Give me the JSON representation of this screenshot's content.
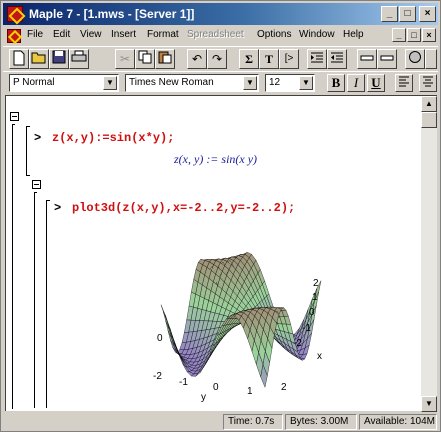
{
  "window": {
    "title": "Maple 7 - [1.mws - [Server 1]]"
  },
  "title_buttons": [
    "_",
    "□",
    "×"
  ],
  "menu": {
    "items": [
      {
        "label": "File"
      },
      {
        "label": "Edit"
      },
      {
        "label": "View"
      },
      {
        "label": "Insert"
      },
      {
        "label": "Format"
      },
      {
        "label": "Spreadsheet",
        "disabled": true
      },
      {
        "label": "Options"
      },
      {
        "label": "Window"
      },
      {
        "label": "Help"
      }
    ],
    "child_buttons": [
      "_",
      "□",
      "×"
    ]
  },
  "toolbar": {
    "buttons": [
      "new-icon",
      "open-icon",
      "save-icon",
      "print-icon",
      "cut-icon",
      "copy-icon",
      "paste-icon",
      "undo-icon",
      "redo-icon",
      "sum-icon",
      "text-icon",
      "exec-icon",
      "indent-icon",
      "outdent-icon",
      "minus-icon",
      "plus-icon",
      "stop-icon",
      "help-icon"
    ]
  },
  "format": {
    "style": "P Normal",
    "font": "Times New Roman",
    "size": "12",
    "bold": "B",
    "italic": "I",
    "underline": "U"
  },
  "worksheet": {
    "prompt": ">",
    "cmd1": "z(x,y):=sin(x*y);",
    "out1": "z(x, y) := sin(x y)",
    "cmd2": "plot3d(z(x,y),x=-2..2,y=-2..2);"
  },
  "plot": {
    "x_ticks": [
      "2",
      "1",
      "0",
      "-1",
      "-2"
    ],
    "y_ticks": [
      "-2",
      "-1",
      "0",
      "1",
      "2"
    ],
    "z_tick": "0",
    "x_label": "x",
    "y_label": "y"
  },
  "status": {
    "time": "Time:  0.7s",
    "bytes": "Bytes:  3.00M",
    "available": "Available:  104M"
  }
}
